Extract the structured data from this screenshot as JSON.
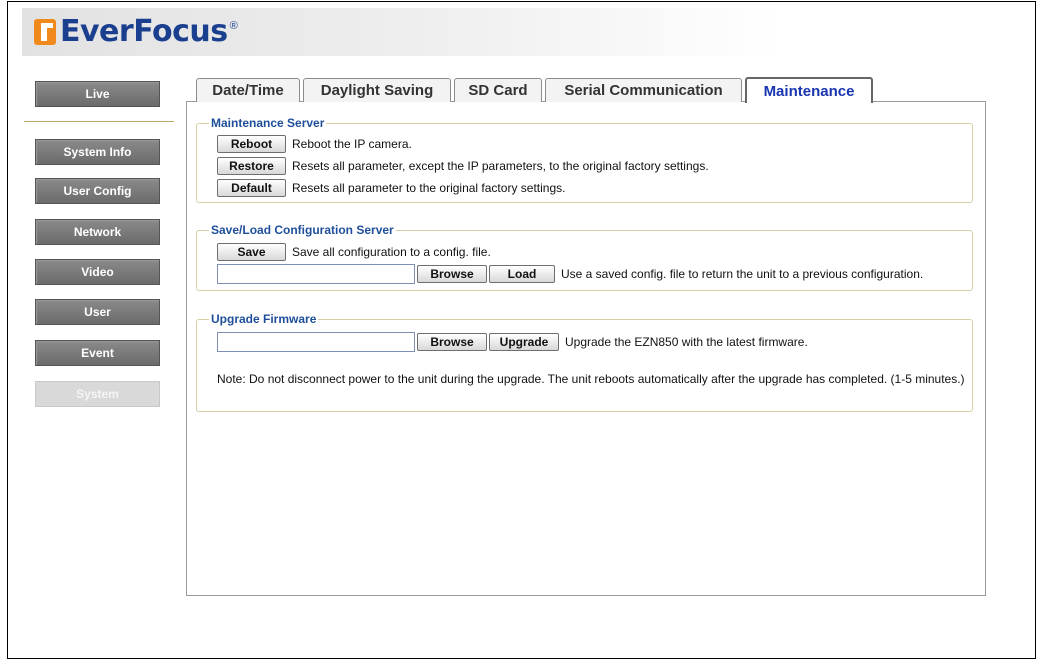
{
  "brand": {
    "name": "EverFocus",
    "reg_mark": "®"
  },
  "sidebar": {
    "items": [
      {
        "label": "Live",
        "active": false
      },
      {
        "label": "System Info",
        "active": false
      },
      {
        "label": "User Config",
        "active": false
      },
      {
        "label": "Network",
        "active": false
      },
      {
        "label": "Video",
        "active": false
      },
      {
        "label": "User",
        "active": false
      },
      {
        "label": "Event",
        "active": false
      },
      {
        "label": "System",
        "active": true
      }
    ]
  },
  "tabs": [
    {
      "label": "Date/Time",
      "active": false
    },
    {
      "label": "Daylight Saving",
      "active": false
    },
    {
      "label": "SD Card",
      "active": false
    },
    {
      "label": "Serial Communication",
      "active": false
    },
    {
      "label": "Maintenance",
      "active": true
    }
  ],
  "maintenance_server": {
    "title": "Maintenance Server",
    "reboot": {
      "button": "Reboot",
      "desc": "Reboot the IP camera."
    },
    "restore": {
      "button": "Restore",
      "desc": "Resets all parameter, except the IP parameters, to the original factory settings."
    },
    "default": {
      "button": "Default",
      "desc": "Resets all parameter to the original factory settings."
    }
  },
  "config_server": {
    "title": "Save/Load Configuration Server",
    "save": {
      "button": "Save",
      "desc": "Save all configuration to a config. file."
    },
    "load": {
      "file_value": "",
      "browse": "Browse",
      "button": "Load",
      "desc": "Use a saved config. file to return the unit to a previous configuration."
    }
  },
  "firmware": {
    "title": "Upgrade Firmware",
    "file_value": "",
    "browse": "Browse",
    "button": "Upgrade",
    "desc": "Upgrade the EZN850 with the latest firmware.",
    "note": "Note: Do not disconnect power to the unit during the upgrade. The unit reboots automatically after the upgrade has completed. (1-5 minutes.)"
  },
  "colors": {
    "brand_blue": "#1b3f8f",
    "logo_orange": "#f08a1c",
    "active_tab_text": "#1a35b0",
    "legend_text": "#1f4f9a"
  }
}
